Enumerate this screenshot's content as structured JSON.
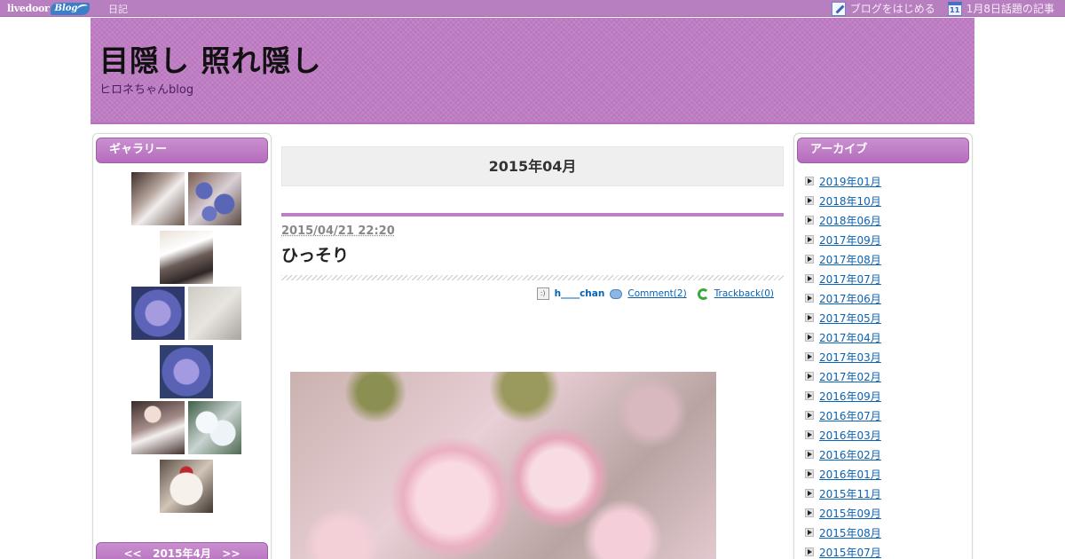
{
  "topbar": {
    "logo_text": "livedoor",
    "logo_blog": "Blog",
    "nav_diary": "日記",
    "start_blog": "ブログをはじめる",
    "calendar_day": "11",
    "topic": "1月8日話題の記事"
  },
  "header": {
    "title": "目隠し 照れ隠し",
    "subtitle": "ヒロネちゃんblog"
  },
  "left_sidebar": {
    "gallery_title": "ギャラリー",
    "calendar_nav": "<<   2015年4月   >>"
  },
  "main": {
    "month_title": "2015年04月",
    "entry": {
      "date": "2015/04/21 22:20",
      "title": "ひっそり",
      "author": "h____chan",
      "comments": "Comment(2)",
      "trackback": "Trackback(0)"
    }
  },
  "right_sidebar": {
    "archive_title": "アーカイブ",
    "archives": [
      "2019年01月",
      "2018年10月",
      "2018年06月",
      "2017年09月",
      "2017年08月",
      "2017年07月",
      "2017年06月",
      "2017年05月",
      "2017年04月",
      "2017年03月",
      "2017年02月",
      "2016年09月",
      "2016年07月",
      "2016年03月",
      "2016年02月",
      "2016年01月",
      "2015年11月",
      "2015年09月",
      "2015年08月",
      "2015年07月"
    ]
  }
}
